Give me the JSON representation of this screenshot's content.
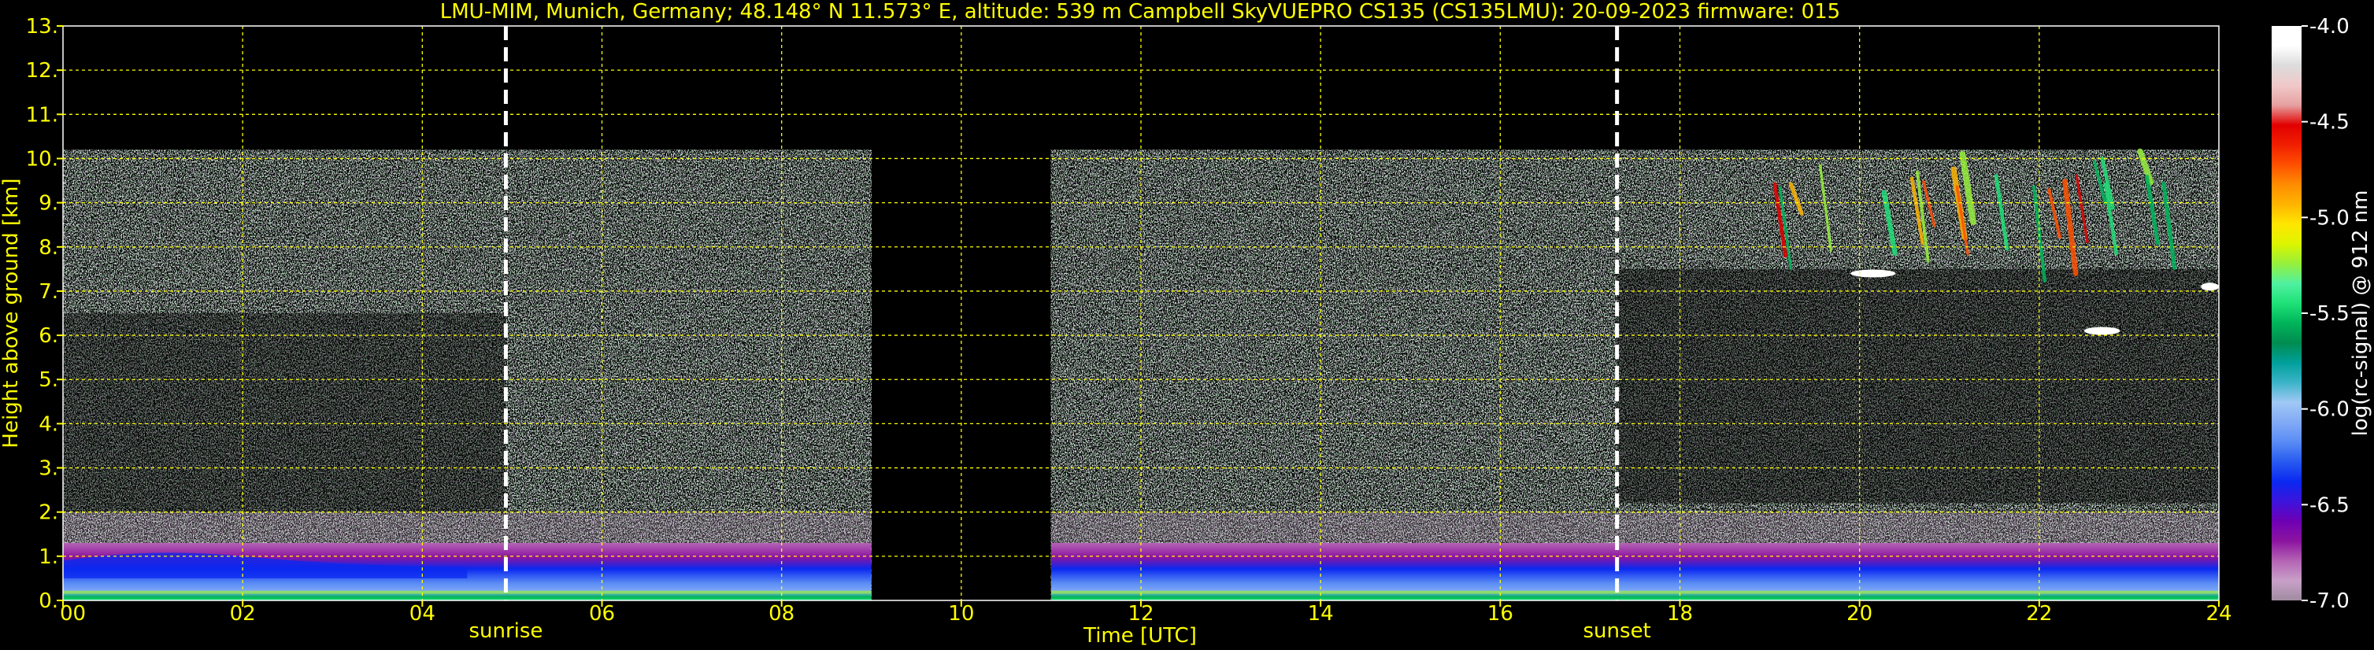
{
  "title": "LMU-MIM, Munich, Germany; 48.148° N 11.573° E, altitude: 539 m    Campbell SkyVUEPRO CS135 (CS135LMU): 20-09-2023    firmware: 015",
  "colors": {
    "text": "#ffff00",
    "grid": "#ffff00",
    "background": "#000000",
    "marker": "#ffffff",
    "colorbar_label": "#ffffff"
  },
  "chart_data": {
    "type": "heatmap",
    "title": "LMU-MIM, Munich, Germany; 48.148° N 11.573° E, altitude: 539 m    Campbell SkyVUEPRO CS135 (CS135LMU): 20-09-2023    firmware: 015",
    "xlabel": "Time [UTC]",
    "ylabel": "Height above ground [km]",
    "xlim": [
      0,
      24
    ],
    "ylim": [
      0,
      13
    ],
    "x_ticks": [
      0,
      2,
      4,
      6,
      8,
      10,
      12,
      14,
      16,
      18,
      20,
      22,
      24
    ],
    "x_tick_labels": [
      "00",
      "02",
      "04",
      "06",
      "08",
      "10",
      "12",
      "14",
      "16",
      "18",
      "20",
      "22",
      "24"
    ],
    "y_ticks": [
      0,
      1,
      2,
      3,
      4,
      5,
      6,
      7,
      8,
      9,
      10,
      11,
      12,
      13
    ],
    "y_tick_labels": [
      "0.",
      "1.",
      "2.",
      "3.",
      "4.",
      "5.",
      "6.",
      "7.",
      "8.",
      "9.",
      "10.",
      "11.",
      "12.",
      "13."
    ],
    "grid": true,
    "data_top_km": 10.2,
    "data_gap_utc": [
      9.0,
      11.0
    ],
    "markers": [
      {
        "label": "sunrise",
        "time_utc": 4.93
      },
      {
        "label": "sunset",
        "time_utc": 17.3
      }
    ],
    "colorbar": {
      "label": "log(rc-signal) @ 912 nm",
      "range": [
        -7.0,
        -4.0
      ],
      "ticks": [
        -4.0,
        -4.5,
        -5.0,
        -5.5,
        -6.0,
        -6.5,
        -7.0
      ],
      "tick_labels": [
        "-4.0",
        "-4.5",
        "-5.0",
        "-5.5",
        "-6.0",
        "-6.5",
        "-7.0"
      ],
      "colors_low_to_high": [
        "#a08ca0",
        "#c8a0c8",
        "#b464b4",
        "#8c14a0",
        "#6e00b4",
        "#3c14dc",
        "#0a28f0",
        "#285af0",
        "#5a8cf5",
        "#82aaf5",
        "#a0c8f5",
        "#3cb4c8",
        "#00a09b",
        "#008c50",
        "#00b45a",
        "#1ee178",
        "#50f0a0",
        "#96f03c",
        "#dcf500",
        "#ffe600",
        "#ffb400",
        "#ff8c00",
        "#ff5000",
        "#f01e00",
        "#e10000",
        "#e6a0a0",
        "#f0c8c8",
        "#dcdcdc",
        "#ffffff",
        "#ffffff"
      ]
    },
    "features": [
      {
        "type": "boundary-layer",
        "t0": 0,
        "t1": 9,
        "top_km": 1.3
      },
      {
        "type": "boundary-layer",
        "t0": 11,
        "t1": 24,
        "top_km": 1.3
      },
      {
        "type": "cirrus",
        "t0": 18.6,
        "t1": 24,
        "base_km": 7.8,
        "top_km": 10.2
      },
      {
        "type": "cloud",
        "t0": 19.9,
        "t1": 20.4,
        "height_km": 7.4
      },
      {
        "type": "cloud",
        "t0": 22.5,
        "t1": 22.9,
        "height_km": 6.1
      },
      {
        "type": "cloud",
        "t0": 23.8,
        "t1": 24,
        "height_km": 7.1
      }
    ]
  }
}
